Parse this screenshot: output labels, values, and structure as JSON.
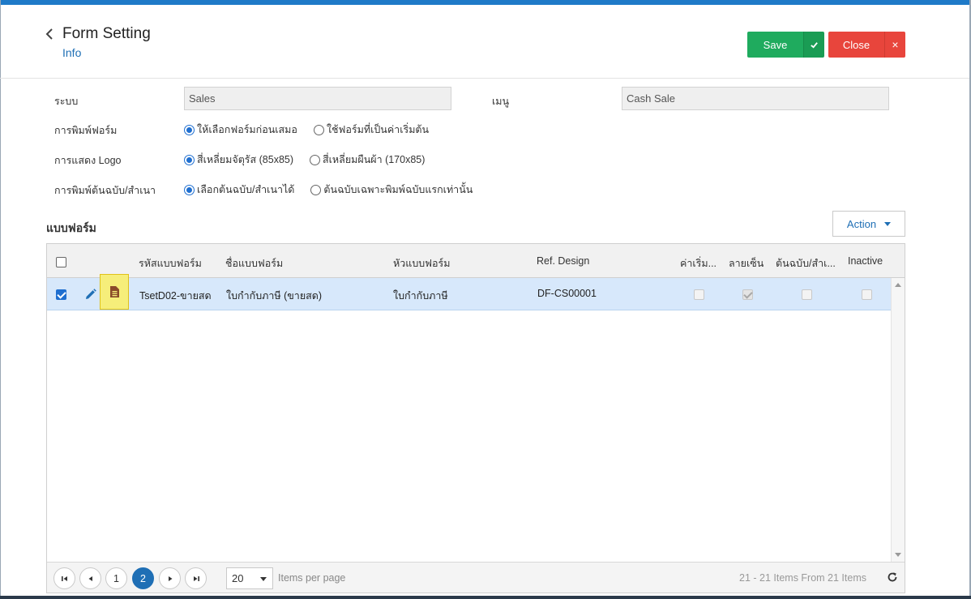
{
  "header": {
    "title": "Form Setting",
    "subtitle": "Info",
    "save_label": "Save",
    "close_label": "Close",
    "close_x": "×"
  },
  "form": {
    "system_label": "ระบบ",
    "system_value": "Sales",
    "menu_label": "เมนู",
    "menu_value": "Cash Sale",
    "print_label": "การพิมพ์ฟอร์ม",
    "print_options": [
      {
        "label": "ให้เลือกฟอร์มก่อนเสมอ",
        "selected": true
      },
      {
        "label": "ใช้ฟอร์มที่เป็นค่าเริ่มต้น",
        "selected": false
      }
    ],
    "logo_label": "การแสดง Logo",
    "logo_options": [
      {
        "label": "สี่เหลี่ยมจัตุรัส (85x85)",
        "selected": true
      },
      {
        "label": "สี่เหลี่ยมผืนผ้า (170x85)",
        "selected": false
      }
    ],
    "copy_label": "การพิมพ์ต้นฉบับ/สำเนา",
    "copy_options": [
      {
        "label": "เลือกต้นฉบับ/สำเนาได้",
        "selected": true
      },
      {
        "label": "ต้นฉบับเฉพาะพิมพ์ฉบับแรกเท่านั้น",
        "selected": false
      }
    ]
  },
  "section": {
    "title": "แบบฟอร์ม",
    "action_label": "Action"
  },
  "grid": {
    "columns": [
      "รหัสแบบฟอร์ม",
      "ชื่อแบบฟอร์ม",
      "หัวแบบฟอร์ม",
      "Ref. Design",
      "ค่าเริ่ม...",
      "ลายเซ็น",
      "ต้นฉบับ/สำเ...",
      "Inactive"
    ],
    "rows": [
      {
        "selected": true,
        "code": "TsetD02-ขายสด",
        "name": "ใบกำกับภาษี (ขายสด)",
        "header": "ใบกำกับภาษี",
        "ref_design": "DF-CS00001",
        "default": false,
        "signature": true,
        "original_copy": false,
        "inactive": false
      }
    ]
  },
  "pager": {
    "pages": [
      "1",
      "2"
    ],
    "current_page": "2",
    "page_size": "20",
    "items_per_page_label": "Items per page",
    "info": "21 - 21 Items From 21 Items"
  },
  "colors": {
    "accent": "#1f6fb5",
    "save": "#1fab5e",
    "close": "#e8453c",
    "row_selected": "#d7e8fb"
  }
}
